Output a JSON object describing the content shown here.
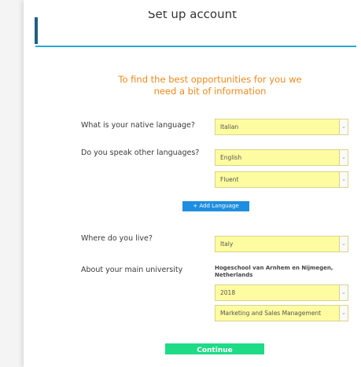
{
  "header": {
    "title": "Set up account"
  },
  "intro": {
    "text": "To find the best opportunities for you we need a bit of information"
  },
  "form": {
    "native_language": {
      "label": "What is your native language?",
      "value": "Italian"
    },
    "other_languages": {
      "label": "Do you speak other languages?",
      "language_value": "English",
      "level_value": "Fluent"
    },
    "add_language_label": "+ Add Language",
    "residence": {
      "label": "Where do you live?",
      "value": "Italy"
    },
    "university": {
      "label": "About your main university",
      "name": "Hogeschool van Arnhem en Nijmegen, Netherlands",
      "year_value": "2018",
      "program_value": "Marketing and Sales Management"
    },
    "continue_label": "Continue"
  },
  "colors": {
    "accent": "#2aa7d3",
    "intro_text": "#f08a1c",
    "field_bg": "#fefca1",
    "add_button": "#1e8ee0",
    "continue_button": "#1edb86"
  },
  "icons": {
    "dropdown": "chevron-down-icon"
  }
}
